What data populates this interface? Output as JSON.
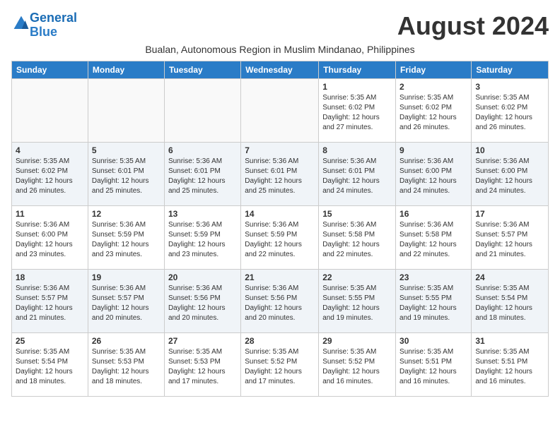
{
  "logo": {
    "line1": "General",
    "line2": "Blue"
  },
  "title": "August 2024",
  "subtitle": "Bualan, Autonomous Region in Muslim Mindanao, Philippines",
  "days_of_week": [
    "Sunday",
    "Monday",
    "Tuesday",
    "Wednesday",
    "Thursday",
    "Friday",
    "Saturday"
  ],
  "weeks": [
    [
      {
        "day": "",
        "info": ""
      },
      {
        "day": "",
        "info": ""
      },
      {
        "day": "",
        "info": ""
      },
      {
        "day": "",
        "info": ""
      },
      {
        "day": "1",
        "info": "Sunrise: 5:35 AM\nSunset: 6:02 PM\nDaylight: 12 hours\nand 27 minutes."
      },
      {
        "day": "2",
        "info": "Sunrise: 5:35 AM\nSunset: 6:02 PM\nDaylight: 12 hours\nand 26 minutes."
      },
      {
        "day": "3",
        "info": "Sunrise: 5:35 AM\nSunset: 6:02 PM\nDaylight: 12 hours\nand 26 minutes."
      }
    ],
    [
      {
        "day": "4",
        "info": "Sunrise: 5:35 AM\nSunset: 6:02 PM\nDaylight: 12 hours\nand 26 minutes."
      },
      {
        "day": "5",
        "info": "Sunrise: 5:35 AM\nSunset: 6:01 PM\nDaylight: 12 hours\nand 25 minutes."
      },
      {
        "day": "6",
        "info": "Sunrise: 5:36 AM\nSunset: 6:01 PM\nDaylight: 12 hours\nand 25 minutes."
      },
      {
        "day": "7",
        "info": "Sunrise: 5:36 AM\nSunset: 6:01 PM\nDaylight: 12 hours\nand 25 minutes."
      },
      {
        "day": "8",
        "info": "Sunrise: 5:36 AM\nSunset: 6:01 PM\nDaylight: 12 hours\nand 24 minutes."
      },
      {
        "day": "9",
        "info": "Sunrise: 5:36 AM\nSunset: 6:00 PM\nDaylight: 12 hours\nand 24 minutes."
      },
      {
        "day": "10",
        "info": "Sunrise: 5:36 AM\nSunset: 6:00 PM\nDaylight: 12 hours\nand 24 minutes."
      }
    ],
    [
      {
        "day": "11",
        "info": "Sunrise: 5:36 AM\nSunset: 6:00 PM\nDaylight: 12 hours\nand 23 minutes."
      },
      {
        "day": "12",
        "info": "Sunrise: 5:36 AM\nSunset: 5:59 PM\nDaylight: 12 hours\nand 23 minutes."
      },
      {
        "day": "13",
        "info": "Sunrise: 5:36 AM\nSunset: 5:59 PM\nDaylight: 12 hours\nand 23 minutes."
      },
      {
        "day": "14",
        "info": "Sunrise: 5:36 AM\nSunset: 5:59 PM\nDaylight: 12 hours\nand 22 minutes."
      },
      {
        "day": "15",
        "info": "Sunrise: 5:36 AM\nSunset: 5:58 PM\nDaylight: 12 hours\nand 22 minutes."
      },
      {
        "day": "16",
        "info": "Sunrise: 5:36 AM\nSunset: 5:58 PM\nDaylight: 12 hours\nand 22 minutes."
      },
      {
        "day": "17",
        "info": "Sunrise: 5:36 AM\nSunset: 5:57 PM\nDaylight: 12 hours\nand 21 minutes."
      }
    ],
    [
      {
        "day": "18",
        "info": "Sunrise: 5:36 AM\nSunset: 5:57 PM\nDaylight: 12 hours\nand 21 minutes."
      },
      {
        "day": "19",
        "info": "Sunrise: 5:36 AM\nSunset: 5:57 PM\nDaylight: 12 hours\nand 20 minutes."
      },
      {
        "day": "20",
        "info": "Sunrise: 5:36 AM\nSunset: 5:56 PM\nDaylight: 12 hours\nand 20 minutes."
      },
      {
        "day": "21",
        "info": "Sunrise: 5:36 AM\nSunset: 5:56 PM\nDaylight: 12 hours\nand 20 minutes."
      },
      {
        "day": "22",
        "info": "Sunrise: 5:35 AM\nSunset: 5:55 PM\nDaylight: 12 hours\nand 19 minutes."
      },
      {
        "day": "23",
        "info": "Sunrise: 5:35 AM\nSunset: 5:55 PM\nDaylight: 12 hours\nand 19 minutes."
      },
      {
        "day": "24",
        "info": "Sunrise: 5:35 AM\nSunset: 5:54 PM\nDaylight: 12 hours\nand 18 minutes."
      }
    ],
    [
      {
        "day": "25",
        "info": "Sunrise: 5:35 AM\nSunset: 5:54 PM\nDaylight: 12 hours\nand 18 minutes."
      },
      {
        "day": "26",
        "info": "Sunrise: 5:35 AM\nSunset: 5:53 PM\nDaylight: 12 hours\nand 18 minutes."
      },
      {
        "day": "27",
        "info": "Sunrise: 5:35 AM\nSunset: 5:53 PM\nDaylight: 12 hours\nand 17 minutes."
      },
      {
        "day": "28",
        "info": "Sunrise: 5:35 AM\nSunset: 5:52 PM\nDaylight: 12 hours\nand 17 minutes."
      },
      {
        "day": "29",
        "info": "Sunrise: 5:35 AM\nSunset: 5:52 PM\nDaylight: 12 hours\nand 16 minutes."
      },
      {
        "day": "30",
        "info": "Sunrise: 5:35 AM\nSunset: 5:51 PM\nDaylight: 12 hours\nand 16 minutes."
      },
      {
        "day": "31",
        "info": "Sunrise: 5:35 AM\nSunset: 5:51 PM\nDaylight: 12 hours\nand 16 minutes."
      }
    ]
  ]
}
